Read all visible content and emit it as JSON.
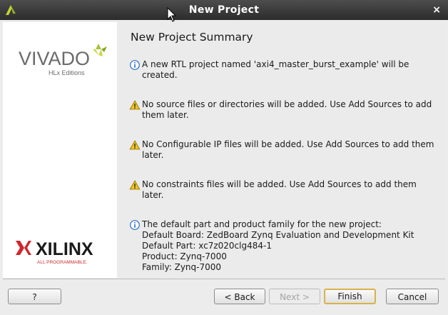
{
  "window": {
    "title": "New Project",
    "close_glyph": "×",
    "icon": "vivado-app-icon"
  },
  "sidebar": {
    "vivado_logo": {
      "text": "VIVADO",
      "sub": "HLx Editions"
    },
    "xilinx_logo": {
      "text": "XILINX",
      "tagline": "ALL PROGRAMMABLE."
    }
  },
  "page": {
    "title": "New Project Summary",
    "messages": [
      {
        "icon": "info-icon",
        "text": "A new RTL project named 'axi4_master_burst_example' will be\ncreated."
      },
      {
        "icon": "warning-icon",
        "text": "No source files or directories will be added. Use Add Sources to add\nthem later."
      },
      {
        "icon": "warning-icon",
        "text": "No Configurable IP files will be added. Use Add Sources to add them\nlater."
      },
      {
        "icon": "warning-icon",
        "text": "No constraints files will be added. Use Add Sources to add them\nlater."
      },
      {
        "icon": "info-icon",
        "text": "The default part and product family for the new project:\nDefault Board: ZedBoard Zynq Evaluation and Development Kit\nDefault Part: xc7z020clg484-1\nProduct: Zynq-7000\nFamily: Zynq-7000"
      }
    ]
  },
  "buttons": {
    "help": "?",
    "back": "< Back",
    "next": "Next >",
    "finish": "Finish",
    "cancel": "Cancel"
  },
  "colors": {
    "titlebar": "#3a3a3a",
    "info": "#2b6cc4",
    "warning": "#f0c419",
    "accent_green": "#a8c23a",
    "xilinx_red": "#d0272c"
  }
}
